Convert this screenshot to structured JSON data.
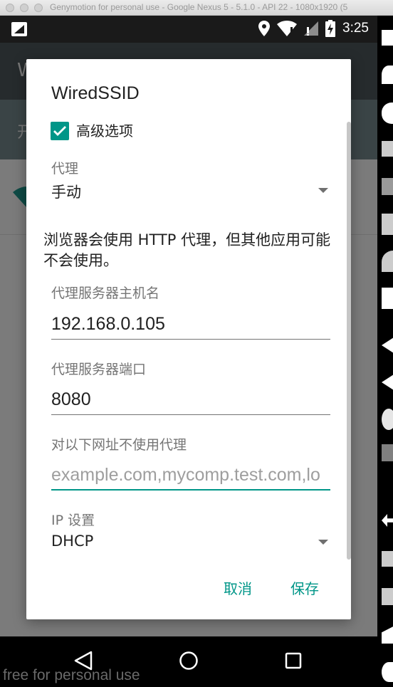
{
  "window": {
    "title": "Genymotion for personal use - Google Nexus 5 - 5.1.0 - API 22 - 1080x1920 (5"
  },
  "status_bar": {
    "time": "3:25"
  },
  "background": {
    "app_title_initial": "W",
    "row_initial": "开"
  },
  "dialog": {
    "title": "WiredSSID",
    "advanced_checkbox": {
      "label": "高级选项",
      "checked": true
    },
    "proxy": {
      "label": "代理",
      "value": "手动"
    },
    "proxy_note": "浏览器会使用 HTTP 代理，但其他应用可能不会使用。",
    "hostname": {
      "label": "代理服务器主机名",
      "value": "192.168.0.105"
    },
    "port": {
      "label": "代理服务器端口",
      "value": "8080"
    },
    "bypass": {
      "label": "对以下网址不使用代理",
      "placeholder": "example.com,mycomp.test.com,lo"
    },
    "ip_settings": {
      "label": "IP 设置",
      "value": "DHCP"
    },
    "cancel_label": "取消",
    "save_label": "保存"
  },
  "watermark": "free for personal use",
  "colors": {
    "accent": "#009688",
    "dialog_bg": "#ffffff",
    "status_bar": "#1a1a1a"
  }
}
